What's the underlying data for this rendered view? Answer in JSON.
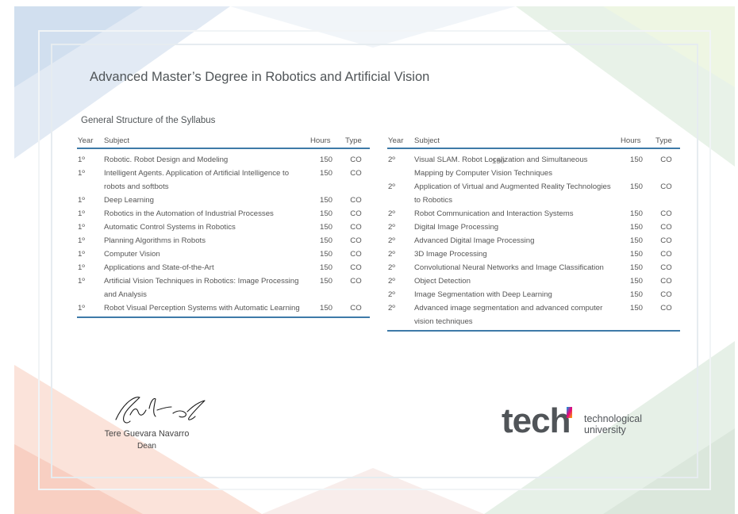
{
  "certificate": {
    "title": "Advanced Master’s Degree in Robotics and Artificial Vision",
    "subtitle": "General Structure of the Syllabus",
    "watermark_number": "150"
  },
  "table_headers": {
    "year": "Year",
    "subject": "Subject",
    "hours": "Hours",
    "type": "Type"
  },
  "left_table": [
    {
      "year": "1º",
      "subject": "Robotic. Robot Design and Modeling",
      "hours": "150",
      "type": "CO"
    },
    {
      "year": "1º",
      "subject": "Intelligent Agents. Application of Artificial Intelligence to",
      "hours": "150",
      "type": "CO"
    },
    {
      "year": "",
      "subject": "robots and softbots",
      "hours": "",
      "type": ""
    },
    {
      "year": "1º",
      "subject": "Deep Learning",
      "hours": "150",
      "type": "CO"
    },
    {
      "year": "1º",
      "subject": "Robotics in the Automation of Industrial Processes",
      "hours": "150",
      "type": "CO"
    },
    {
      "year": "1º",
      "subject": "Automatic Control Systems in Robotics",
      "hours": "150",
      "type": "CO"
    },
    {
      "year": "1º",
      "subject": "Planning Algorithms in Robots",
      "hours": "150",
      "type": "CO"
    },
    {
      "year": "1º",
      "subject": "Computer Vision",
      "hours": "150",
      "type": "CO"
    },
    {
      "year": "1º",
      "subject": "Applications and State-of-the-Art",
      "hours": "150",
      "type": "CO"
    },
    {
      "year": "1º",
      "subject": "Artificial Vision Techniques in Robotics: Image Processing",
      "hours": "150",
      "type": "CO"
    },
    {
      "year": "",
      "subject": "and Analysis",
      "hours": "",
      "type": ""
    },
    {
      "year": "1º",
      "subject": "Robot Visual Perception Systems with Automatic Learning",
      "hours": "150",
      "type": "CO"
    }
  ],
  "right_table": [
    {
      "year": "2º",
      "subject": "Visual SLAM. Robot Localization and Simultaneous",
      "hours": "150",
      "type": "CO"
    },
    {
      "year": "",
      "subject": "Mapping by Computer Vision Techniques",
      "hours": "",
      "type": ""
    },
    {
      "year": "2º",
      "subject": "Application of Virtual and Augmented Reality Technologies",
      "hours": "150",
      "type": "CO"
    },
    {
      "year": "",
      "subject": "to Robotics",
      "hours": "",
      "type": ""
    },
    {
      "year": "2º",
      "subject": "Robot Communication and Interaction Systems",
      "hours": "150",
      "type": "CO"
    },
    {
      "year": "2º",
      "subject": "Digital Image Processing",
      "hours": "150",
      "type": "CO"
    },
    {
      "year": "2º",
      "subject": "Advanced Digital Image Processing",
      "hours": "150",
      "type": "CO"
    },
    {
      "year": "2º",
      "subject": "3D Image Processing",
      "hours": "150",
      "type": "CO"
    },
    {
      "year": "2º",
      "subject": "Convolutional Neural Networks and Image Classification",
      "hours": "150",
      "type": "CO"
    },
    {
      "year": "2º",
      "subject": "Object Detection",
      "hours": "150",
      "type": "CO"
    },
    {
      "year": "2º",
      "subject": "Image Segmentation with Deep Learning",
      "hours": "150",
      "type": "CO"
    },
    {
      "year": "2º",
      "subject": "Advanced image segmentation and advanced computer",
      "hours": "150",
      "type": "CO"
    },
    {
      "year": "",
      "subject": "vision techniques",
      "hours": "",
      "type": ""
    }
  ],
  "signature": {
    "name": "Tere Guevara Navarro",
    "role": "Dean"
  },
  "logo": {
    "wordmark": "tech",
    "line1": "technological",
    "line2": "university"
  },
  "colors": {
    "rule": "#3e7aa8",
    "text": "#4a4a4a",
    "logo_gradient": [
      "#00a8e8",
      "#e6007e",
      "#ffb300"
    ]
  }
}
